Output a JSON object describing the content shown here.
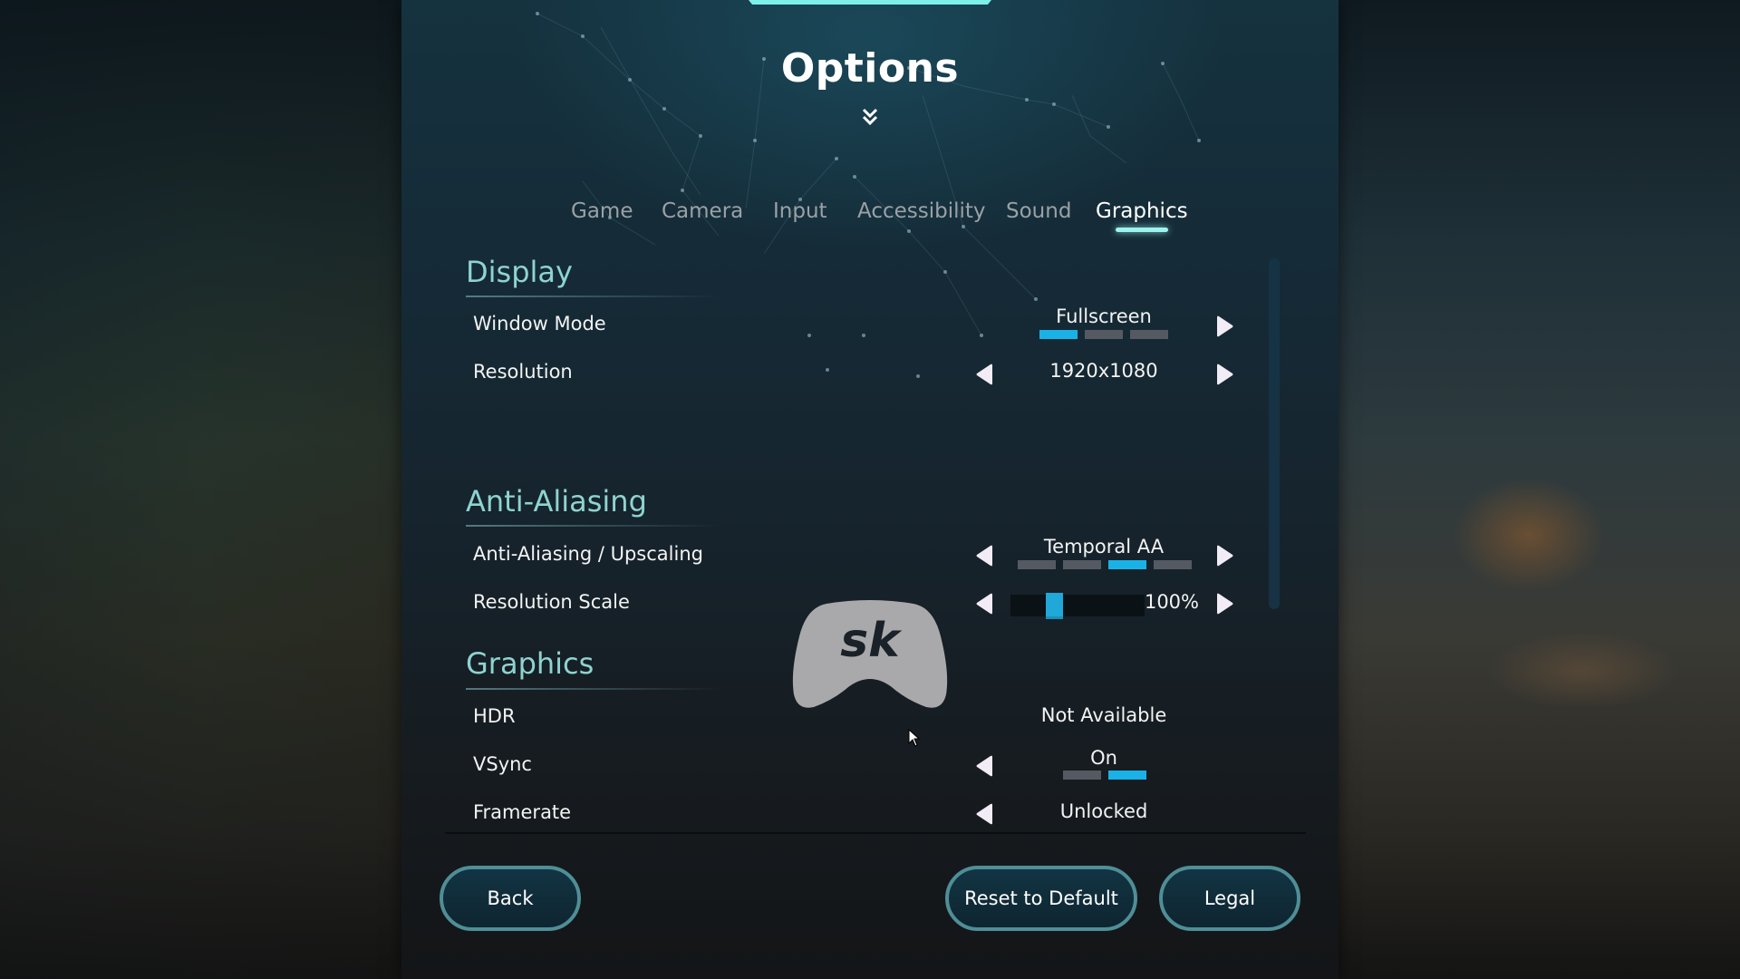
{
  "title": "Options",
  "tabs": [
    {
      "label": "Game",
      "active": false
    },
    {
      "label": "Camera",
      "active": false
    },
    {
      "label": "Input",
      "active": false
    },
    {
      "label": "Accessibility",
      "active": false
    },
    {
      "label": "Sound",
      "active": false
    },
    {
      "label": "Graphics",
      "active": true
    }
  ],
  "sections": {
    "display": {
      "heading": "Display",
      "window_mode": {
        "label": "Window Mode",
        "value": "Fullscreen",
        "options_count": 3,
        "selected_index": 0
      },
      "resolution": {
        "label": "Resolution",
        "value": "1920x1080"
      }
    },
    "anti_aliasing": {
      "heading": "Anti-Aliasing",
      "aa_upscaling": {
        "label": "Anti-Aliasing / Upscaling",
        "value": "Temporal AA",
        "options_count": 4,
        "selected_index": 2
      },
      "resolution_scale": {
        "label": "Resolution Scale",
        "value": "100%",
        "slider_fraction": 0.3
      }
    },
    "graphics": {
      "heading": "Graphics",
      "hdr": {
        "label": "HDR",
        "value": "Not Available"
      },
      "vsync": {
        "label": "VSync",
        "value": "On",
        "options_count": 2,
        "selected_index": 1
      },
      "framerate": {
        "label": "Framerate",
        "value": "Unlocked"
      }
    }
  },
  "buttons": {
    "back": "Back",
    "reset": "Reset to Default",
    "legal": "Legal"
  },
  "colors": {
    "accent": "#7ef0ea",
    "heading": "#8fd3d0",
    "pip_on": "#1ab2e6",
    "pip_off": "#555a62",
    "button_border": "#4f8e97"
  },
  "logo": {
    "text": "sk"
  }
}
